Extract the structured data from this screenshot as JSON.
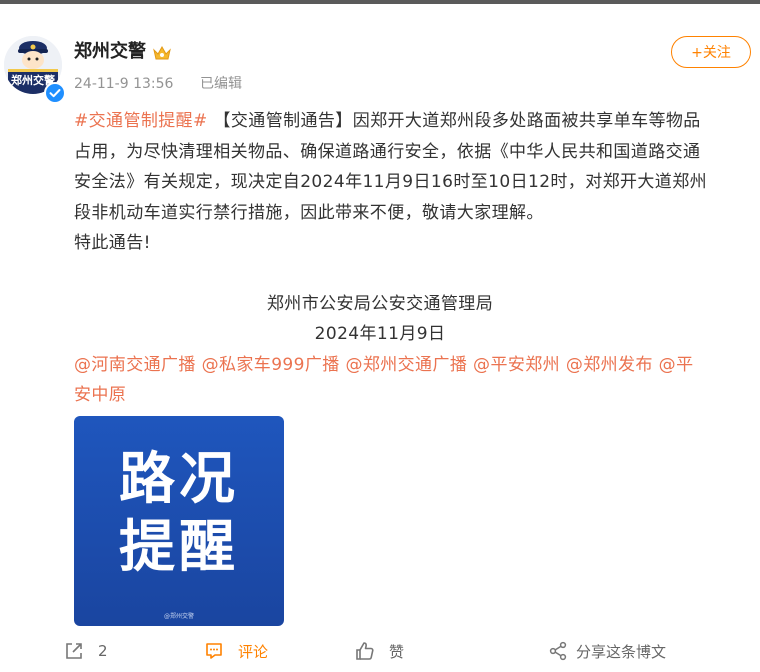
{
  "post": {
    "author": "郑州交警",
    "avatar_text": "郑州交警",
    "timestamp": "24-11-9 13:56",
    "edited_label": "已编辑",
    "follow_label": "+关注",
    "hashtag": "#交通管制提醒#",
    "line1_rest": " 【交通管制通告】因郑开大道郑州段多处路面被共享单车等物品",
    "line2": "占用，为尽快清理相关物品、确保道路通行安全，依据《中华人民共和国道路交通",
    "line3": "安全法》有关规定，现决定自2024年11月9日16时至10日12时，对郑开大道郑州",
    "line4": "段非机动车道实行禁行措施，因此带来不便，敬请大家理解。",
    "line5": "特此通告!",
    "signature": "郑州市公安局公安交通管理局",
    "sign_date": "2024年11月9日",
    "mentions_line1": "@河南交通广播 @私家车999广播 @郑州交通广播 @平安郑州 @郑州发布 @平",
    "mentions_line2": "安中原",
    "image_line1": "路况",
    "image_line2": "提醒",
    "image_watermark": "@郑州交警"
  },
  "actions": {
    "repost_count": "2",
    "comment_label": "评论",
    "like_label": "赞",
    "share_label": "分享这条博文"
  },
  "colors": {
    "accent": "#ff8200",
    "link": "#eb7350",
    "verified": "#1f8fff",
    "image_bg": "#1e4fb0"
  }
}
